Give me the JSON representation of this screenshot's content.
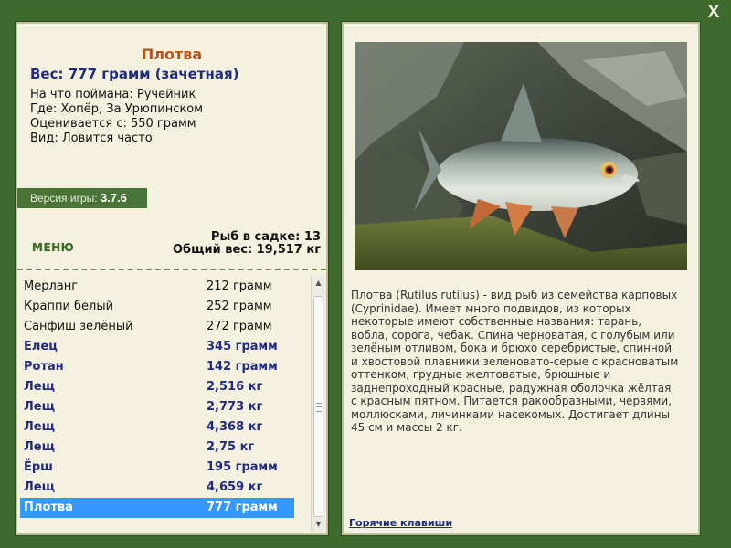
{
  "window": {
    "close_label": "X"
  },
  "fish": {
    "title": "Плотва",
    "weight": "Вес: 777 грамм (зачетная)",
    "info": [
      "На что поймана: Ручейник",
      "Где: Хопёр, За Урюпинском",
      "Оценивается с: 550 грамм",
      "Вид: Ловится часто"
    ]
  },
  "version": {
    "label": "Версия игры:",
    "value": "3.7.6"
  },
  "menu": {
    "label": "МЕНЮ"
  },
  "cage": {
    "count": "Рыб в садке: 13",
    "total": "Общий вес: 19,517 кг"
  },
  "catch_list": [
    {
      "name": "Мерланг",
      "weight": "212 грамм",
      "style": "normal"
    },
    {
      "name": "Краппи белый",
      "weight": "252 грамм",
      "style": "normal"
    },
    {
      "name": "Санфиш зелёный",
      "weight": "272 грамм",
      "style": "normal"
    },
    {
      "name": "Елец",
      "weight": "345 грамм",
      "style": "highlight"
    },
    {
      "name": "Ротан",
      "weight": "142 грамм",
      "style": "highlight"
    },
    {
      "name": "Лещ",
      "weight": "2,516 кг",
      "style": "highlight"
    },
    {
      "name": "Лещ",
      "weight": "2,773 кг",
      "style": "highlight"
    },
    {
      "name": "Лещ",
      "weight": "4,368 кг",
      "style": "highlight"
    },
    {
      "name": "Лещ",
      "weight": "2,75 кг",
      "style": "highlight"
    },
    {
      "name": "Ёрш",
      "weight": "195 грамм",
      "style": "highlight"
    },
    {
      "name": "Лещ",
      "weight": "4,659 кг",
      "style": "highlight"
    },
    {
      "name": "Плотва",
      "weight": "777 грамм",
      "style": "selected"
    }
  ],
  "description": "Плотва (Rutilus rutilus) - вид рыб из семейства карповых (Cyprinidae). Имеет много подвидов, из которых некоторые имеют собственные названия: тарань, вобла, сорога, чебак. Спина черноватая, с голубым или зелёным отливом, бока и брюхо серебристые, спинной и хвостовой плавники зеленовато-серые с красноватым оттенком, грудные желтоватые, брюшные и заднепроходный красные, радужная оболочка жёлтая с красным пятном. Питается ракообразными, червями, моллюсками, личинками насекомых. Достигает длины 45 см и массы 2 кг.",
  "hotkeys": {
    "label": "Горячие клавиши"
  },
  "colors": {
    "background": "#3f6a2e",
    "panel": "#f4f1de",
    "title": "#b8531b",
    "highlight_text": "#1f2a80",
    "selection": "#3399ff",
    "menu": "#3a6a29"
  }
}
